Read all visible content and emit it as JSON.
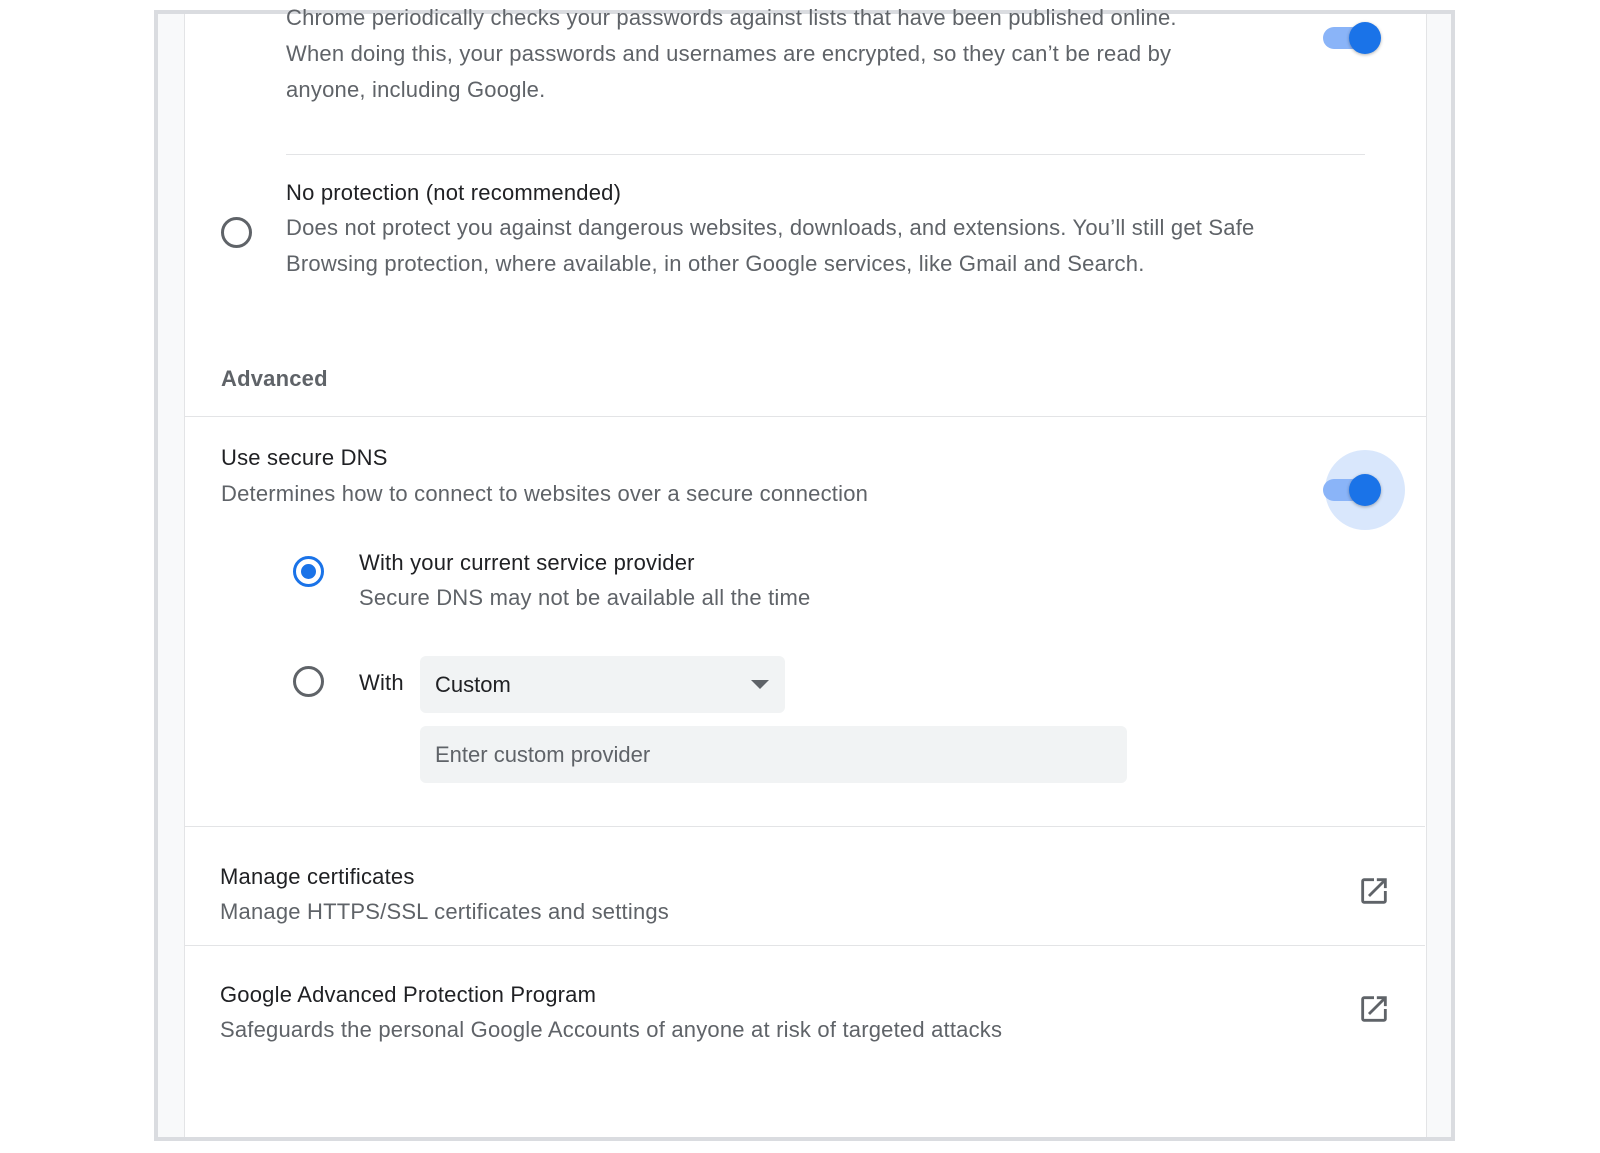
{
  "password_check": {
    "text_line1": "Chrome periodically checks your passwords against lists that have been published online.",
    "text_line2": "When doing this, your passwords and usernames are encrypted, so they can’t be read by",
    "text_line3": "anyone, including Google.",
    "toggle_on": true
  },
  "no_protection": {
    "title": "No protection (not recommended)",
    "desc_line1": "Does not protect you against dangerous websites, downloads, and extensions. You’ll still get Safe",
    "desc_line2": "Browsing protection, where available, in other Google services, like Gmail and Search."
  },
  "advanced": {
    "heading": "Advanced"
  },
  "secure_dns": {
    "title": "Use secure DNS",
    "desc": "Determines how to connect to websites over a secure connection",
    "toggle_on": true,
    "option_current_title": "With your current service provider",
    "option_current_desc": "Secure DNS may not be available all the time",
    "option_with_label": "With",
    "provider_select_value": "Custom",
    "custom_provider_placeholder": "Enter custom provider"
  },
  "manage_certificates": {
    "title": "Manage certificates",
    "desc": "Manage HTTPS/SSL certificates and settings",
    "icon": "open-in-new-icon"
  },
  "advanced_protection": {
    "title": "Google Advanced Protection Program",
    "desc": "Safeguards the personal Google Accounts of anyone at risk of targeted attacks",
    "icon": "open-in-new-icon"
  },
  "colors": {
    "accent": "#1a73e8",
    "toggle_track": "#8ab4f8",
    "secondary_text": "#5f6368"
  }
}
